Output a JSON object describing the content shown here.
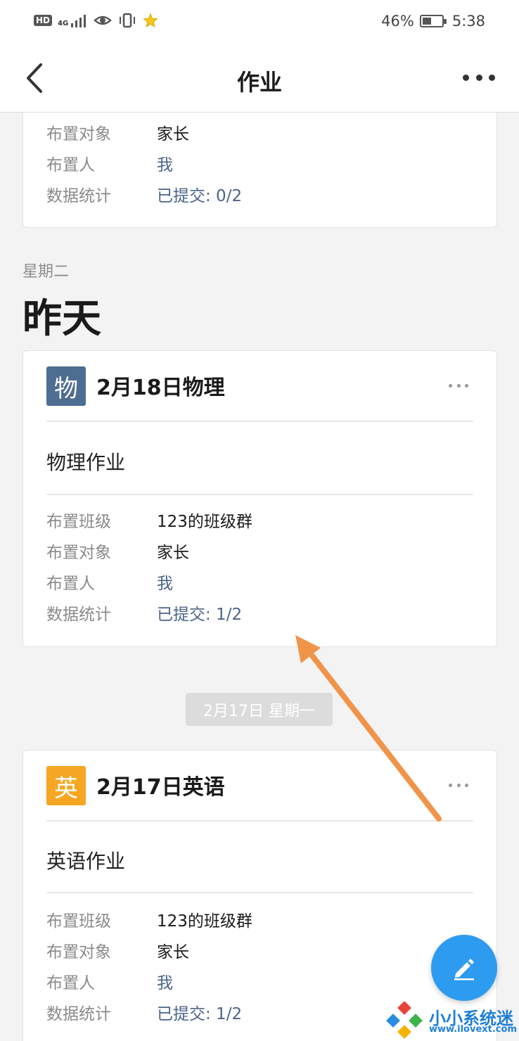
{
  "status_bar": {
    "hd": "HD",
    "network": "4G",
    "battery_text": "46%",
    "battery_level": 0.46,
    "time": "5:38"
  },
  "nav": {
    "title": "作业",
    "back_icon": "chevron-left-icon",
    "more_icon": "more-horizontal-icon"
  },
  "partial_card": {
    "rows": [
      {
        "key": "布置对象",
        "value": "家长"
      },
      {
        "key": "布置人",
        "value": "我"
      },
      {
        "key": "数据统计",
        "value": "已提交: 0/2"
      }
    ]
  },
  "section": {
    "weekday": "星期二",
    "day_label": "昨天"
  },
  "physics_card": {
    "icon_char": "物",
    "icon_color": "#4e6d92",
    "title": "2月18日物理",
    "description": "物理作业",
    "rows": [
      {
        "key": "布置班级",
        "value": "123的班级群"
      },
      {
        "key": "布置对象",
        "value": "家长"
      },
      {
        "key": "布置人",
        "value": "我"
      },
      {
        "key": "数据统计",
        "value": "已提交: 1/2"
      }
    ]
  },
  "date_separator": "2月17日 星期一",
  "english_card": {
    "icon_char": "英",
    "icon_color": "#f5a623",
    "title": "2月17日英语",
    "description": "英语作业",
    "rows": [
      {
        "key": "布置班级",
        "value": "123的班级群"
      },
      {
        "key": "布置对象",
        "value": "家长"
      },
      {
        "key": "布置人",
        "value": "我"
      },
      {
        "key": "数据统计",
        "value": "已提交: 1/2"
      }
    ]
  },
  "fab": {
    "icon": "pencil-icon",
    "color": "#2d9bf0"
  },
  "annotation": {
    "arrow_color": "#f0944a"
  },
  "watermark": {
    "title": "小小系统迷",
    "url": "www.ilovext.com"
  }
}
